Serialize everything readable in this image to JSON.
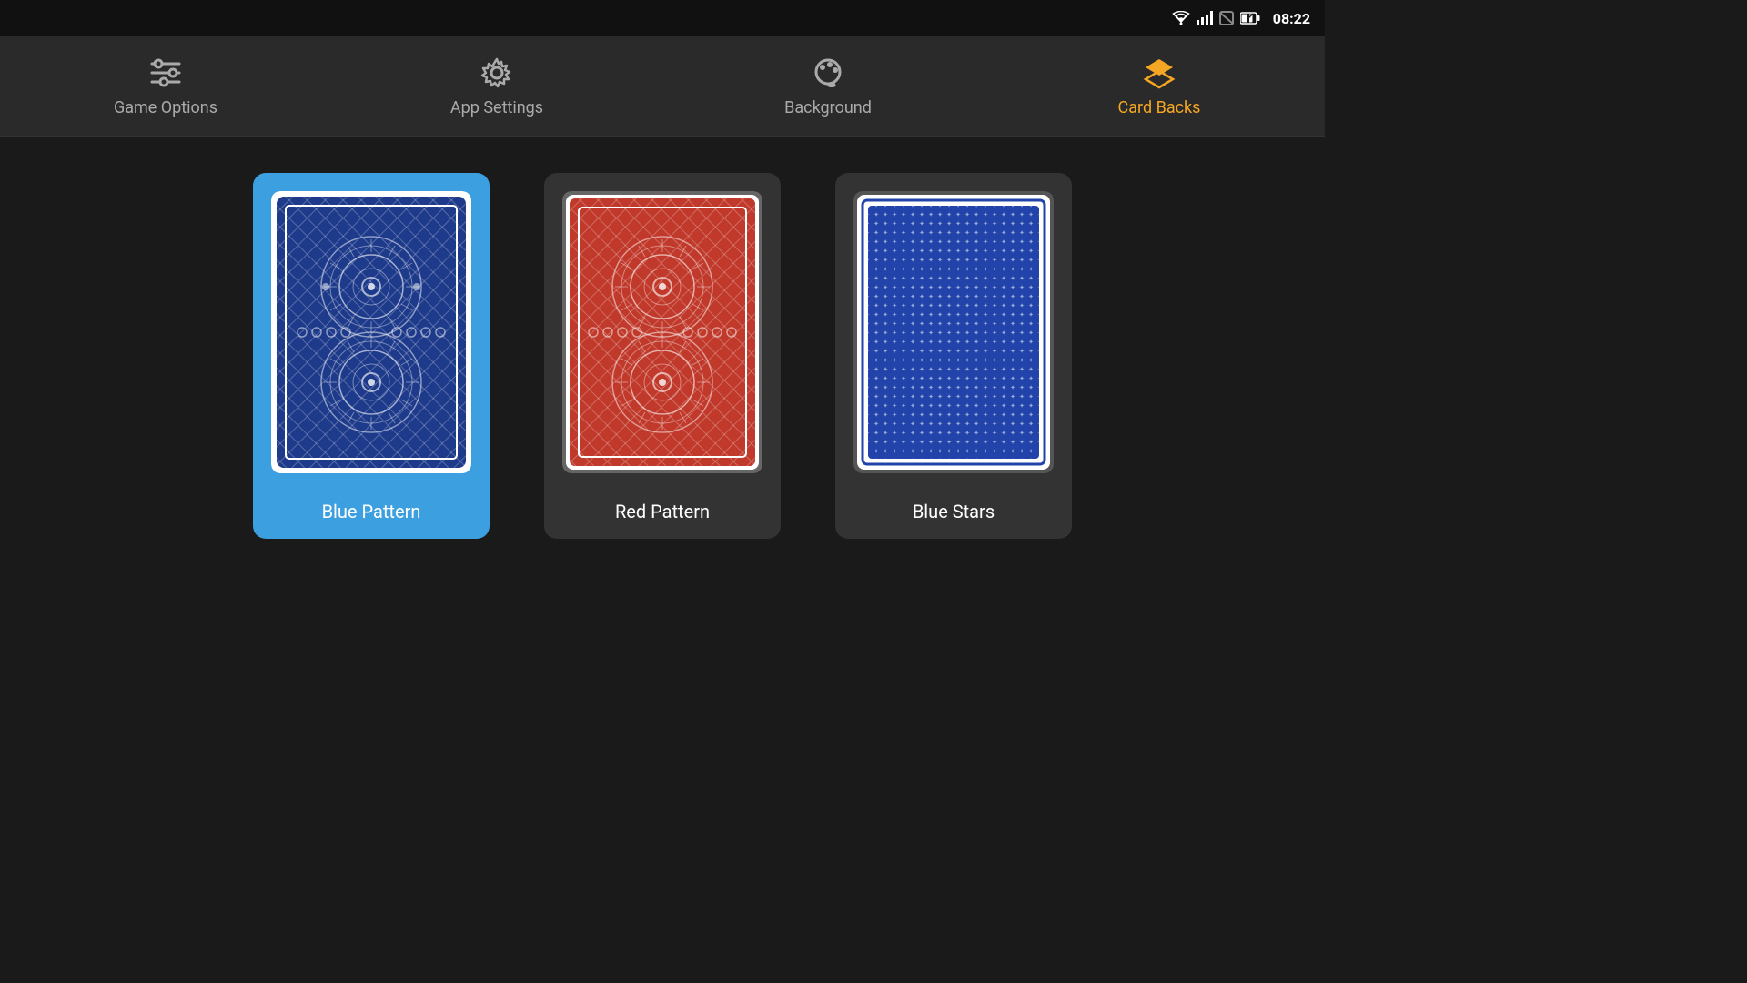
{
  "statusBar": {
    "time": "08:22"
  },
  "nav": {
    "items": [
      {
        "id": "game-options",
        "label": "Game Options",
        "active": false
      },
      {
        "id": "app-settings",
        "label": "App Settings",
        "active": false
      },
      {
        "id": "background",
        "label": "Background",
        "active": false
      },
      {
        "id": "card-backs",
        "label": "Card Backs",
        "active": true
      }
    ]
  },
  "cardBacks": {
    "cards": [
      {
        "id": "blue-pattern",
        "label": "Blue Pattern",
        "selected": true,
        "color": "blue"
      },
      {
        "id": "red-pattern",
        "label": "Red Pattern",
        "selected": false,
        "color": "red"
      },
      {
        "id": "blue-stars",
        "label": "Blue Stars",
        "selected": false,
        "color": "blue-stars"
      }
    ]
  },
  "colors": {
    "accent": "#f5a623",
    "selected": "#3b9fe0",
    "unselected": "#333333"
  }
}
